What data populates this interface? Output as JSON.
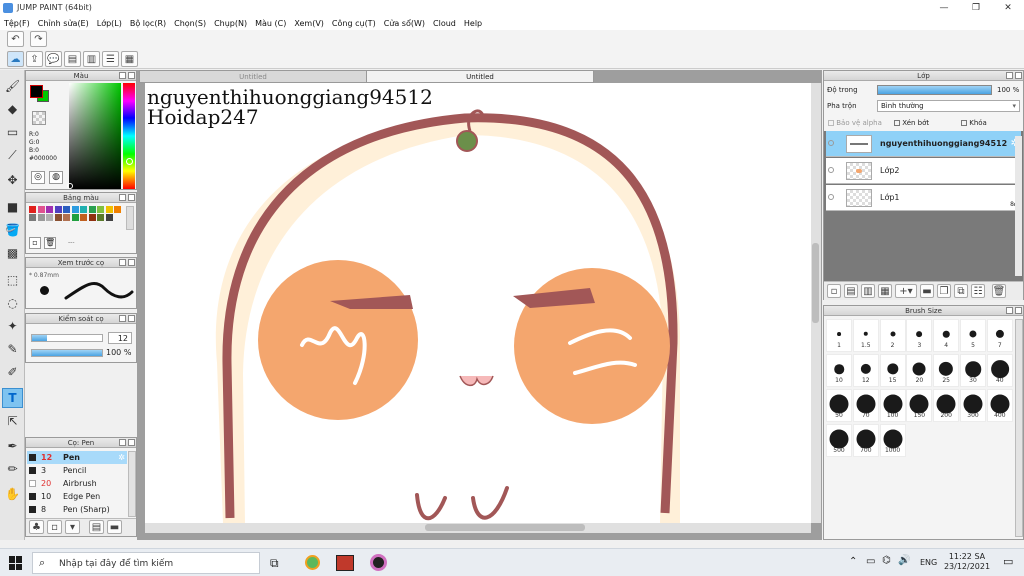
{
  "window": {
    "title": "JUMP PAINT (64bit)"
  },
  "menu": [
    "Tệp(F)",
    "Chỉnh sửa(E)",
    "Lớp(L)",
    "Bộ lọc(R)",
    "Chọn(S)",
    "Chụp(N)",
    "Màu (C)",
    "Xem(V)",
    "Công cụ(T)",
    "Cửa sổ(W)",
    "Cloud",
    "Help"
  ],
  "color_panel": {
    "title": "Màu",
    "r": "R:0",
    "g": "G:0",
    "b": "B:0",
    "hex": "#000000",
    "fg": "#000000",
    "bg": "#00c800"
  },
  "palette_panel": {
    "title": "Bảng màu",
    "ellipsis": "---",
    "swatches": [
      "#e0211d",
      "#e0528f",
      "#a030b0",
      "#5040c0",
      "#2a5ec0",
      "#2c9ce0",
      "#20b0b0",
      "#2aa050",
      "#80c040",
      "#f0c000",
      "#f08000",
      "#7a7a7a",
      "#9a9a9a",
      "#b0b0b0",
      "#8a5030",
      "#b07050",
      "#20a040",
      "#c06020",
      "#903010",
      "#5a7a2a",
      "#404040"
    ]
  },
  "preview_panel": {
    "title": "Xem trước cọ",
    "size": "0.87mm"
  },
  "brush_control": {
    "title": "Kiểm soát cọ",
    "size": "12",
    "opacity": "100 %"
  },
  "brush_list": {
    "title": "Cọ: Pen",
    "items": [
      {
        "num": "12",
        "name": "Pen"
      },
      {
        "num": "3",
        "name": "Pencil"
      },
      {
        "num": "20",
        "name": "Airbrush"
      },
      {
        "num": "10",
        "name": "Edge Pen"
      },
      {
        "num": "8",
        "name": "Pen (Sharp)"
      }
    ]
  },
  "tabs": [
    "Untitled",
    "Untitled"
  ],
  "canvas": {
    "line1": "nguyenthihuonggiang94512",
    "line2": "Hoidap247"
  },
  "layer_panel": {
    "title": "Lớp",
    "opacity_label": "Độ trong",
    "opacity_value": "100 %",
    "blend_label": "Pha trộn",
    "blend_value": "Bình thường",
    "protect_alpha": "Bảo vệ alpha",
    "clip": "Xén bớt",
    "lock": "Khóa",
    "layers": [
      "nguyenthihuonggiang94512",
      "Lớp2",
      "Lớp1"
    ]
  },
  "brush_size": {
    "title": "Brush Size",
    "sizes": [
      "1",
      "1.5",
      "2",
      "3",
      "4",
      "5",
      "7",
      "10",
      "12",
      "15",
      "20",
      "25",
      "30",
      "40",
      "50",
      "70",
      "100",
      "150",
      "200",
      "300",
      "400",
      "500",
      "700",
      "1000"
    ]
  },
  "taskbar": {
    "search_placeholder": "Nhập tại đây để tìm kiếm",
    "lang": "ENG",
    "time": "11:22 SA",
    "date": "23/12/2021"
  }
}
